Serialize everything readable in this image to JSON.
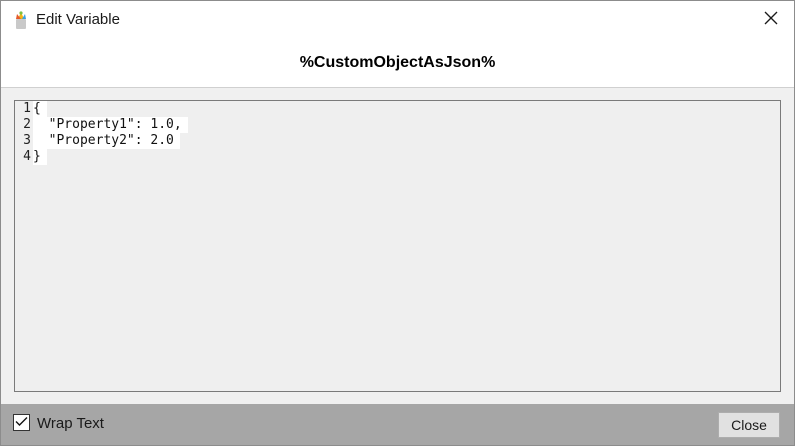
{
  "window": {
    "title": "Edit Variable",
    "icon": "app-logo-icon",
    "close_icon": "close-icon"
  },
  "header": {
    "variable_name": "%CustomObjectAsJson%"
  },
  "editor": {
    "lines": [
      {
        "number": "1",
        "text": "{"
      },
      {
        "number": "2",
        "text": "  \"Property1\": 1.0,"
      },
      {
        "number": "3",
        "text": "  \"Property2\": 2.0"
      },
      {
        "number": "4",
        "text": "}"
      }
    ]
  },
  "footer": {
    "wrap_text_label": "Wrap Text",
    "wrap_text_checked": true,
    "close_label": "Close"
  },
  "colors": {
    "footer_bg": "#a6a6a6",
    "editor_bg": "#efefef",
    "button_bg": "#e1e1e1"
  }
}
